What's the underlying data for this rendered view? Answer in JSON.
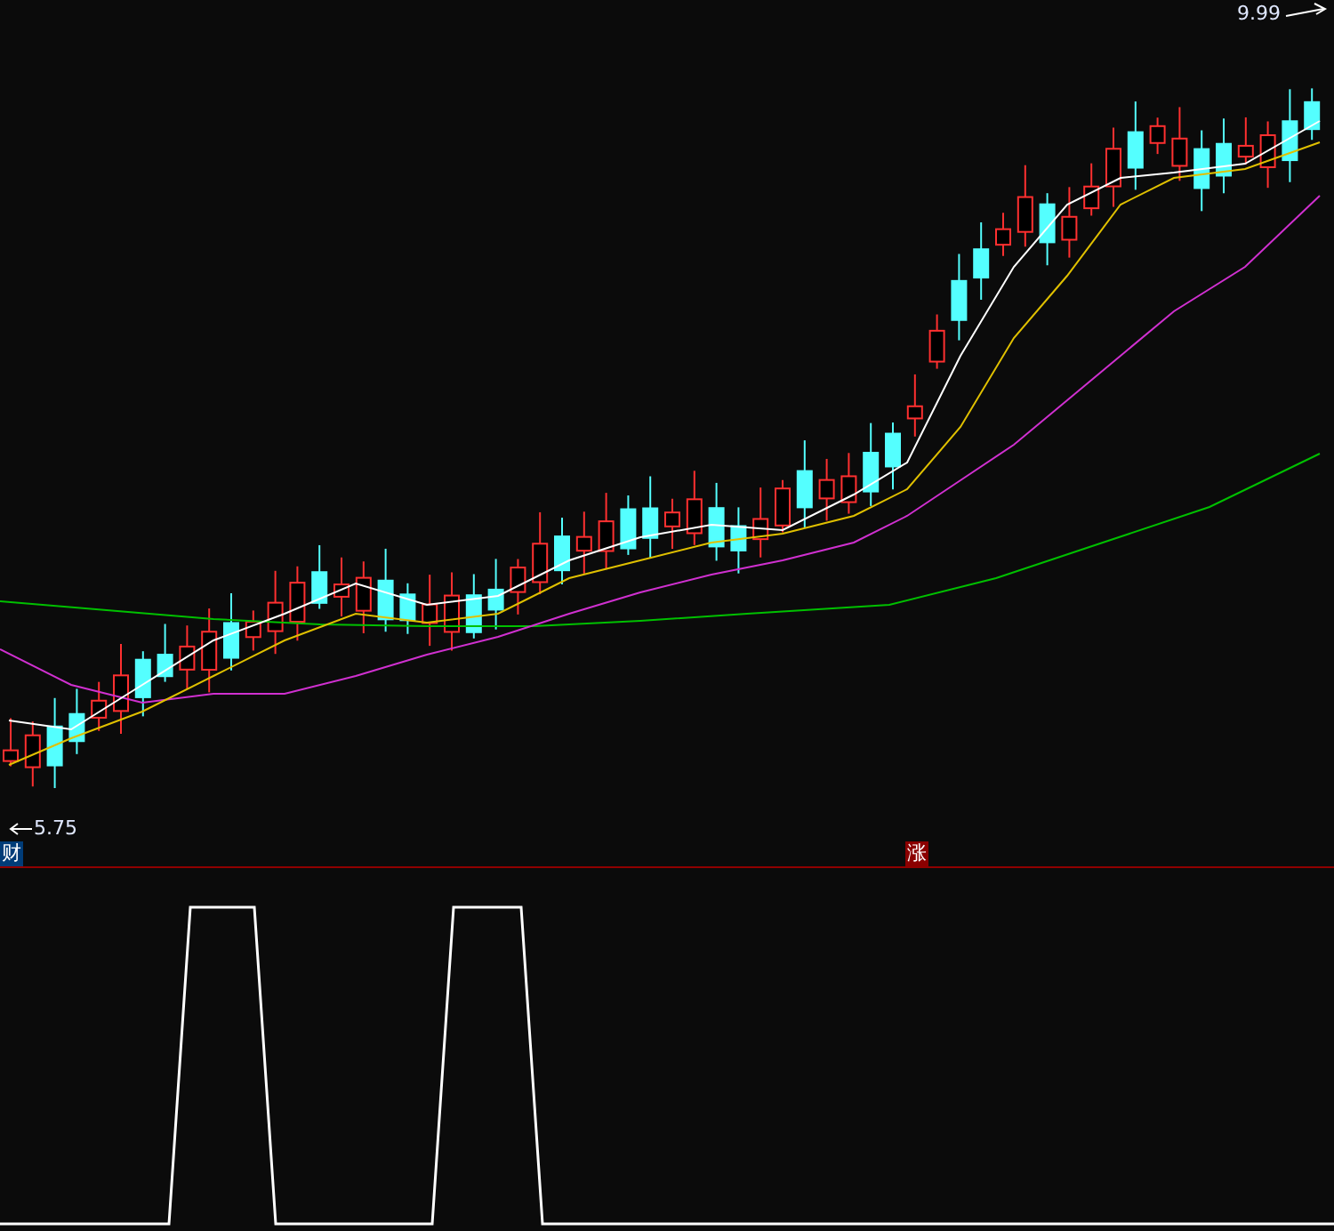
{
  "price_chart": {
    "high_label": "9.99",
    "low_label": "5.75"
  },
  "markers": [
    {
      "text": "财",
      "kind": "finance"
    },
    {
      "text": "涨",
      "kind": "rise"
    }
  ]
}
